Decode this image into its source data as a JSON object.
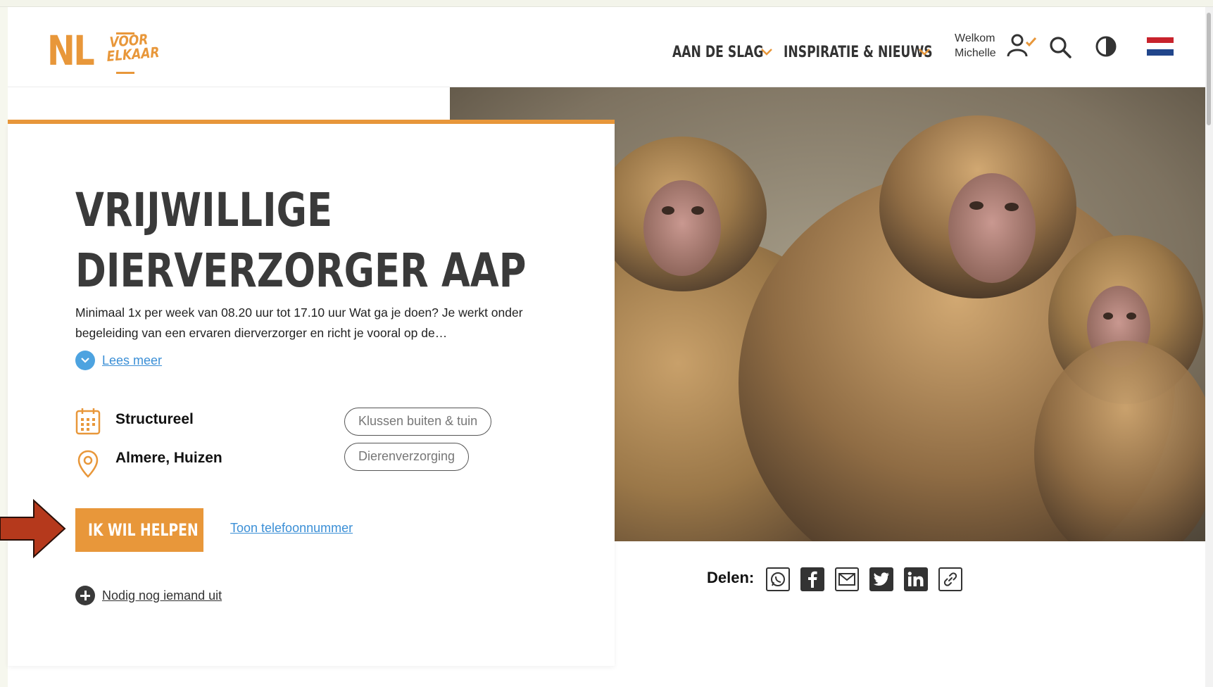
{
  "header": {
    "logo": {
      "nl": "NL",
      "voor": "VOOR",
      "elkaar": "ELKAAR"
    },
    "nav": [
      {
        "label": "AAN DE SLAG"
      },
      {
        "label": "INSPIRATIE & NIEUWS"
      }
    ],
    "welcome_line1": "Welkom",
    "welcome_line2": "Michelle",
    "icons": [
      "user-check-icon",
      "search-icon",
      "contrast-icon",
      "dutch-flag-icon"
    ]
  },
  "vacancy": {
    "title_line1": "VRIJWILLIGE",
    "title_line2": "DIERVERZORGER AAP",
    "description": "Minimaal 1x per week van 08.20 uur tot 17.10 uur Wat ga je doen? Je werkt onder begeleiding van een ervaren dierverzorger en richt je vooral op de…",
    "read_more": "Lees meer",
    "type": "Structureel",
    "location": "Almere, Huizen",
    "tags": [
      "Klussen buiten & tuin",
      "Dierenverzorging"
    ],
    "cta_label": "IK WIL HELPEN",
    "phone_link": "Toon telefoonnummer",
    "invite_link": "Nodig nog iemand uit"
  },
  "share": {
    "label": "Delen:",
    "buttons": [
      "whatsapp-icon",
      "facebook-icon",
      "email-icon",
      "twitter-icon",
      "linkedin-icon",
      "link-icon"
    ]
  },
  "colors": {
    "accent": "#e8973a",
    "link": "#3b8fd6",
    "text_dark": "#3a3a3a",
    "annotation_arrow": "#b5391c"
  }
}
